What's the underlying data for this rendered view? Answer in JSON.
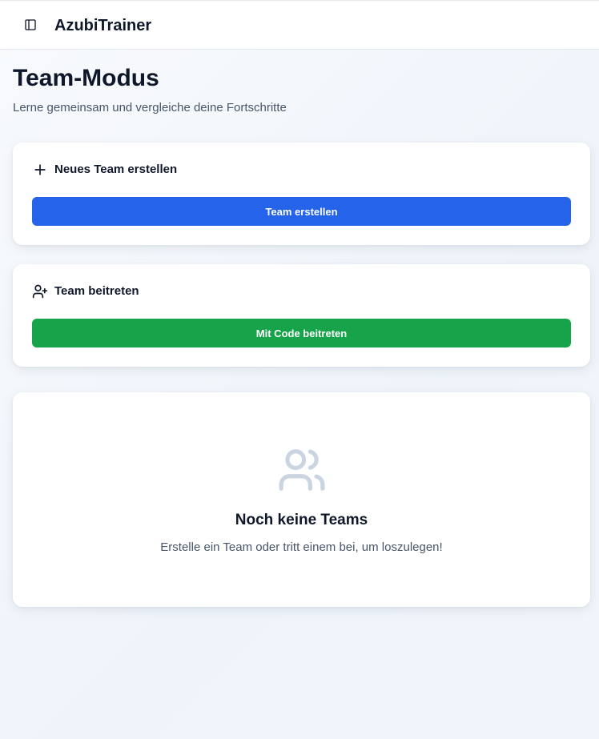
{
  "header": {
    "app_title": "AzubiTrainer",
    "sidebar_toggle_icon": "sidebar-panel-icon"
  },
  "page": {
    "title": "Team-Modus",
    "subtitle": "Lerne gemeinsam und vergleiche deine Fortschritte"
  },
  "create_team": {
    "icon": "plus-icon",
    "heading": "Neues Team erstellen",
    "button_label": "Team erstellen",
    "button_color": "#2563eb"
  },
  "join_team": {
    "icon": "user-plus-icon",
    "heading": "Team beitreten",
    "button_label": "Mit Code beitreten",
    "button_color": "#16a34a"
  },
  "empty_state": {
    "icon": "users-icon",
    "title": "Noch keine Teams",
    "text": "Erstelle ein Team oder tritt einem bei, um loszulegen!"
  }
}
